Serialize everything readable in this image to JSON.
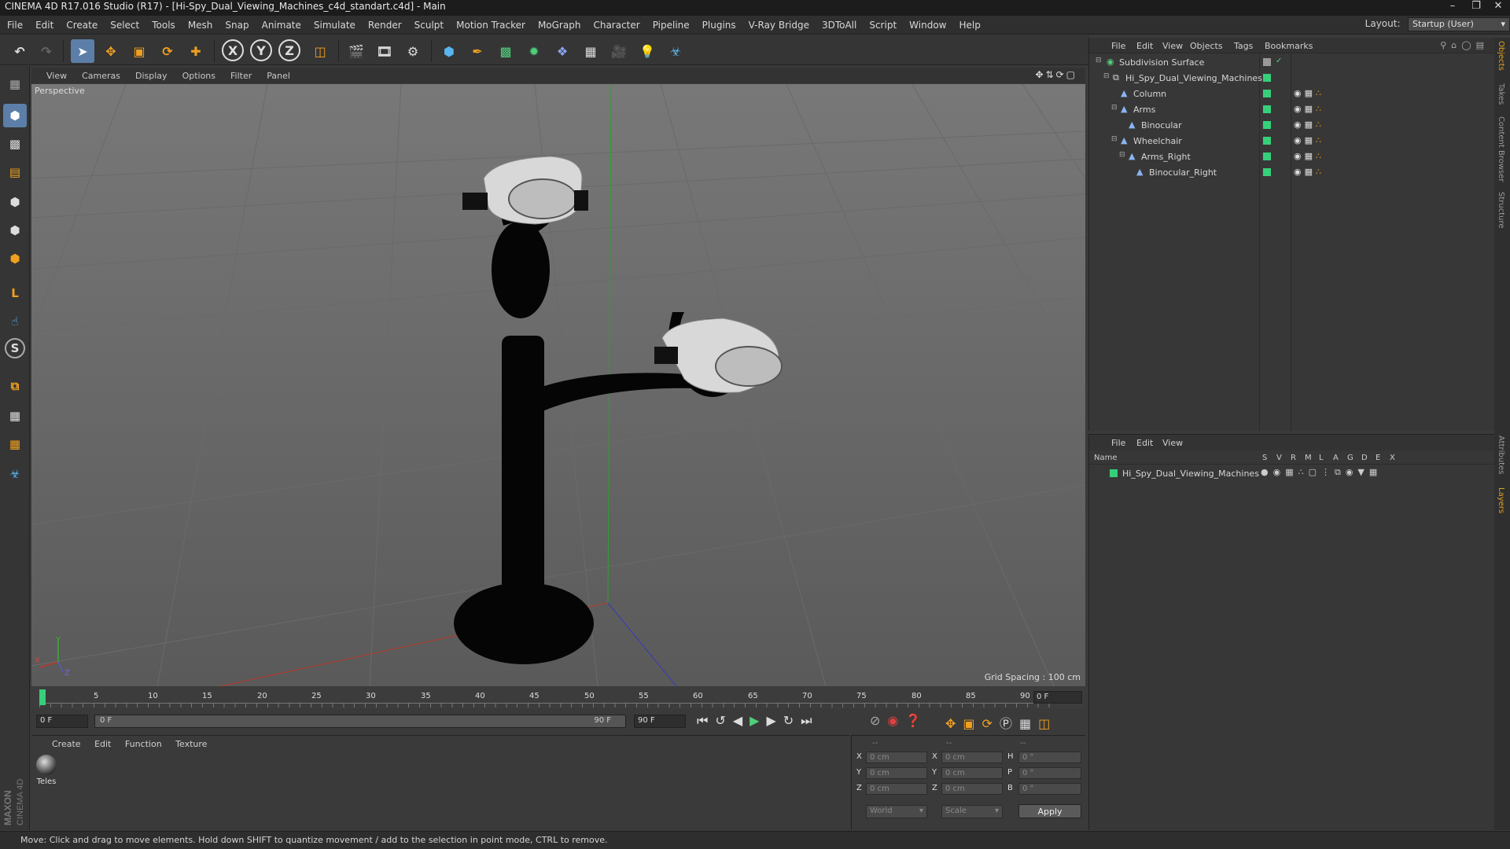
{
  "window": {
    "title": "CINEMA 4D R17.016 Studio (R17) - [Hi-Spy_Dual_Viewing_Machines_c4d_standart.c4d] - Main"
  },
  "menubar": {
    "items": [
      "File",
      "Edit",
      "Create",
      "Select",
      "Tools",
      "Mesh",
      "Snap",
      "Animate",
      "Simulate",
      "Render",
      "Sculpt",
      "Motion Tracker",
      "MoGraph",
      "Character",
      "Pipeline",
      "Plugins",
      "V-Ray Bridge",
      "3DToAll",
      "Script",
      "Window",
      "Help"
    ],
    "layout_label": "Layout:",
    "layout_value": "Startup (User)"
  },
  "toolbar": {
    "axis_x": "X",
    "axis_y": "Y",
    "axis_z": "Z"
  },
  "viewport": {
    "menu": [
      "View",
      "Cameras",
      "Display",
      "Options",
      "Filter",
      "Panel"
    ],
    "camera_label": "Perspective",
    "grid_spacing": "Grid Spacing : 100 cm",
    "axis_y": "Y",
    "axis_z": "Z",
    "axis_x": "X"
  },
  "timeline": {
    "ticks": [
      "0",
      "5",
      "10",
      "15",
      "20",
      "25",
      "30",
      "35",
      "40",
      "45",
      "50",
      "55",
      "60",
      "65",
      "70",
      "75",
      "80",
      "85",
      "90"
    ],
    "current_frame": "0 F",
    "start_field": "0 F",
    "range_start": "0 F",
    "range_end": "90 F",
    "end_field": "90 F"
  },
  "material_manager": {
    "menu": [
      "Create",
      "Edit",
      "Function",
      "Texture"
    ],
    "materials": [
      {
        "name": "Teles"
      }
    ]
  },
  "coordinates": {
    "header": [
      "--",
      "--",
      "--"
    ],
    "rows": [
      {
        "l1": "X",
        "v1": "0 cm",
        "l2": "X",
        "v2": "0 cm",
        "l3": "H",
        "v3": "0 °"
      },
      {
        "l1": "Y",
        "v1": "0 cm",
        "l2": "Y",
        "v2": "0 cm",
        "l3": "P",
        "v3": "0 °"
      },
      {
        "l1": "Z",
        "v1": "0 cm",
        "l2": "Z",
        "v2": "0 cm",
        "l3": "B",
        "v3": "0 °"
      }
    ],
    "mode": "World",
    "type": "Scale",
    "apply": "Apply"
  },
  "object_manager": {
    "menu": [
      "File",
      "Edit",
      "View",
      "Objects",
      "Tags",
      "Bookmarks"
    ],
    "objects": [
      {
        "name": "Subdivision Surface",
        "depth": 0,
        "icon": "subdivision-icon"
      },
      {
        "name": "Hi_Spy_Dual_Viewing_Machines",
        "depth": 1,
        "icon": "null-icon"
      },
      {
        "name": "Column",
        "depth": 2,
        "icon": "polygon-icon"
      },
      {
        "name": "Arms",
        "depth": 2,
        "icon": "polygon-icon"
      },
      {
        "name": "Binocular",
        "depth": 3,
        "icon": "polygon-icon"
      },
      {
        "name": "Wheelchair",
        "depth": 2,
        "icon": "polygon-icon"
      },
      {
        "name": "Arms_Right",
        "depth": 3,
        "icon": "polygon-icon"
      },
      {
        "name": "Binocular_Right",
        "depth": 4,
        "icon": "polygon-icon"
      }
    ]
  },
  "layer_manager": {
    "menu": [
      "File",
      "Edit",
      "View"
    ],
    "columns": [
      "Name",
      "S",
      "V",
      "R",
      "M",
      "L",
      "A",
      "G",
      "D",
      "E",
      "X"
    ],
    "layers": [
      {
        "name": "Hi_Spy_Dual_Viewing_Machines",
        "color": "#36d07a"
      }
    ]
  },
  "right_tabs": [
    "Objects",
    "Takes",
    "Content Browser",
    "Structure",
    "Attributes",
    "Layers"
  ],
  "status": {
    "text": "Move: Click and drag to move elements. Hold down SHIFT to quantize movement / add to the selection in point mode, CTRL to remove."
  },
  "branding": {
    "logo": "MAXON CINEMA 4D"
  }
}
